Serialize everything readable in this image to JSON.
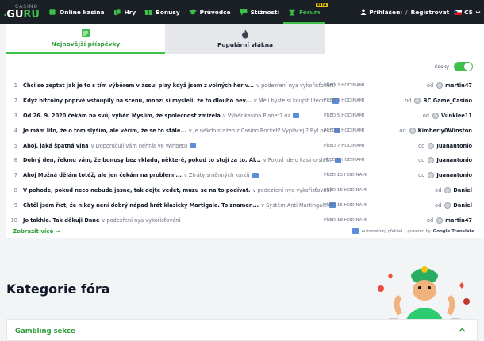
{
  "logo": {
    "small": "CASINO",
    "big_a": "GU",
    "big_b": "RU"
  },
  "nav": {
    "items": [
      {
        "label": "Online kasina",
        "icon": "clover-icon"
      },
      {
        "label": "Hry",
        "icon": "cards-icon"
      },
      {
        "label": "Bonusy",
        "icon": "gift-icon"
      },
      {
        "label": "Průvodce",
        "icon": "graduation-cap-icon"
      },
      {
        "label": "Stížnosti",
        "icon": "chat-icon"
      },
      {
        "label": "Fórum",
        "icon": "users-icon",
        "badge": "BETA"
      }
    ],
    "login": "Přihlášení",
    "register": "Registrovat",
    "lang": "CS"
  },
  "tabs": [
    {
      "label": "Nejnovější příspěvky",
      "icon": "message-icon"
    },
    {
      "label": "Populární vlákna",
      "icon": "fire-icon"
    }
  ],
  "toggle": {
    "label": "česky",
    "on": true
  },
  "posts": [
    {
      "n": "1",
      "title": "Chci se zeptat jak je to s tím výběrem v assui play když jsem z volných her v...",
      "in": "v podezření nya vykořisťování",
      "translated": false,
      "time": "PŘED 2 HODINAMI",
      "od": "od",
      "user": "martin47"
    },
    {
      "n": "2",
      "title": "Když bitcoiny poprvé vstoupily na scénu, mnozí si mysleli, že to dlouho nev...",
      "in": "v Měli byste si koupit liteco...",
      "translated": true,
      "time": "PŘED 3 HODINAMI",
      "od": "od",
      "user": "BC.Game_Casino"
    },
    {
      "n": "3",
      "title": "Od 26. 9. 2020 čekám na svůj výběr. Myslím, že společnost zmizela",
      "in": "v Výběr kasina Planet7 oz",
      "translated": true,
      "time": "PŘED 5 HODINAMI",
      "od": "od",
      "user": "Vunklee11"
    },
    {
      "n": "4",
      "title": "Je mám lito, že o tom slyším, ale věřím, že se to stále...",
      "in": "v Je někdo stažen z Casino Rocket? Vyplácejí? Byl pe...",
      "translated": true,
      "time": "PŘED 6 HODINAMI",
      "od": "od",
      "user": "Kimberly0Winston"
    },
    {
      "n": "5",
      "title": "Ahoj, jaká špatná vlna",
      "in": "v Doporučují vám nehrát ve Winbetu",
      "translated": true,
      "time": "PŘED 7 HODINAMI",
      "od": "od",
      "user": "Juanantonio"
    },
    {
      "n": "6",
      "title": "Dobrý den, řekmu vám, že bonusy bez vkladu, některé, pokud to stojí za to. Al...",
      "in": "v Pokud jde o kasino slot...",
      "translated": true,
      "time": "PŘED 8 HODINAMI",
      "od": "od",
      "user": "Juanantonio"
    },
    {
      "n": "7",
      "title": "Ahoj Možná dělám totéž, ale jen čekám na problém ...",
      "in": "v Ztráty směnných kurzů",
      "translated": true,
      "time": "PŘED 13 HODINAMI",
      "od": "od",
      "user": "Juanantonio"
    },
    {
      "n": "8",
      "title": "V pohode, pokud neco nebude jasne, tak dejte vedet, muzu se na to podívat.",
      "in": "v podezření nya vykořisťování",
      "translated": false,
      "time": "PŘED 15 HODINAMI",
      "od": "od",
      "user": "Daniel"
    },
    {
      "n": "9",
      "title": "Chtěl jsem říct, že nikdy není dobrý nápad hrát klasický Martigale. To znamen...",
      "in": "v Systém Anti Martingale",
      "translated": true,
      "time": "PŘED 15 HODINAMI",
      "od": "od",
      "user": "Daniel"
    },
    {
      "n": "10",
      "title": "Jo takhle. Tak děkuji Dane",
      "in": "v podezření nya vykořisťování",
      "translated": false,
      "time": "PŘED 18 HODINAMI",
      "od": "od",
      "user": "martin47"
    }
  ],
  "show_more": "Zobrazit více →",
  "google_translate": {
    "auto": "Automatický překlad",
    "powered": "powered by",
    "brand": "Google Translate"
  },
  "category": {
    "title": "Kategorie fóra",
    "panel_title": "Gambling sekce"
  },
  "colors": {
    "brand_green": "#3ec04a",
    "nav_bg": "#1b1f26",
    "translate_blue": "#5b8dd9"
  }
}
